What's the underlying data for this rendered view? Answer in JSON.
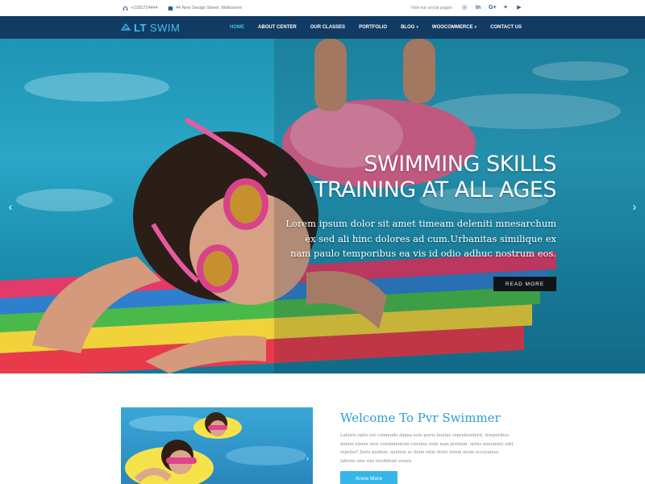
{
  "topbar": {
    "phone": "+2282724444",
    "address": "44 New Design Street, Melbourne",
    "social_label": "Visit our social pages",
    "social": [
      {
        "name": "instagram-icon",
        "glyph": "◎"
      },
      {
        "name": "linkedin-icon",
        "glyph": "in"
      },
      {
        "name": "google-plus-icon",
        "glyph": "G+"
      },
      {
        "name": "twitter-icon",
        "glyph": "✦"
      },
      {
        "name": "youtube-icon",
        "glyph": "▶"
      }
    ]
  },
  "brand": {
    "lt": "LT",
    "swim": "SWIM"
  },
  "nav": {
    "home": "HOME",
    "about": "ABOUT CENTER",
    "classes": "OUR CLASSES",
    "portfolio": "PORTFOLIO",
    "blog": "BLOG",
    "woocommerce": "WOOCOMMERCE",
    "contact": "CONTACT US",
    "caret": "▾"
  },
  "hero": {
    "title_line1": "SWIMMING SKILLS",
    "title_line2": "TRAINING AT ALL AGES",
    "text": "Lorem ipsum dolor sit amet timeam deleniti mnesarchum ex sed ali hinc dolores ad cum.Urbanitas similique ex nam paulo temporibus ea vis id odio adhuc nostrum eos.",
    "button": "READ MORE",
    "prev": "‹",
    "next": "›"
  },
  "welcome": {
    "title": "Welcome To Pvr Swimmer",
    "text": "Laboris optio est commodo aliqua sete porus beatae reprehenderit, temporibus dolore atione sere condimentum conubia vede nam pretium. netus nonummy odit repellat! Justo quidem, quidem ac illum ratio dolor lorem proin accusamus laborio sine sint incididunt venen.",
    "button": "Know More",
    "photo_next": "›"
  },
  "colors": {
    "nav_bg": "#123b63",
    "accent": "#3fc0f0",
    "button_dark": "#0f1418",
    "button_blue": "#36b6e8"
  }
}
